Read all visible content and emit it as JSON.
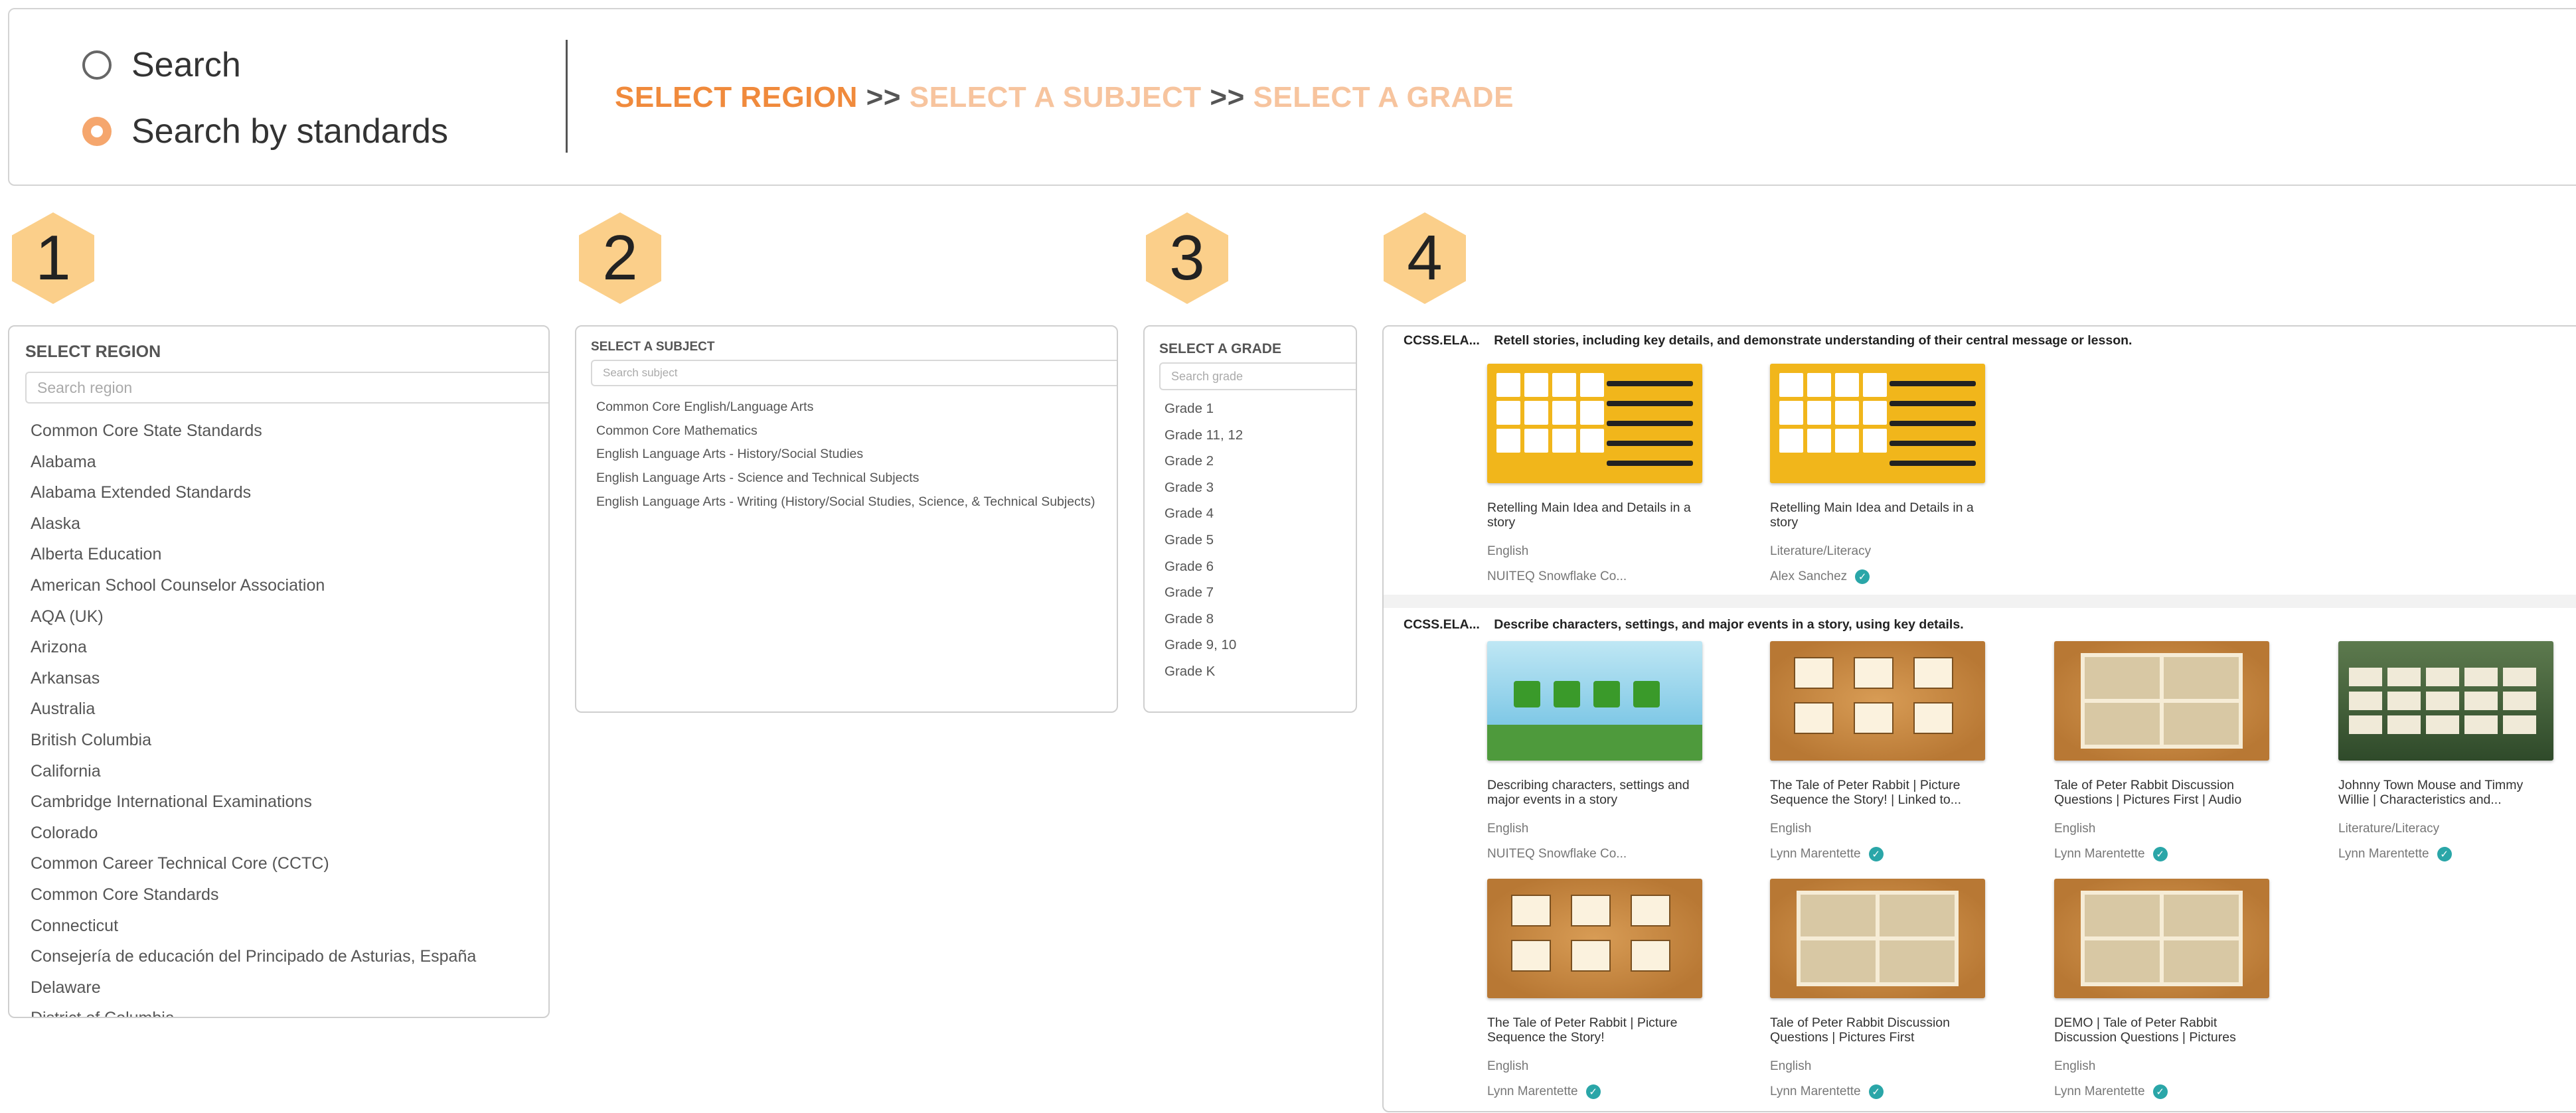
{
  "search_mode": {
    "options": [
      {
        "label": "Search",
        "selected": false
      },
      {
        "label": "Search by standards",
        "selected": true
      }
    ]
  },
  "breadcrumb": {
    "step1": "SELECT REGION",
    "sep": ">>",
    "step2": "SELECT A SUBJECT",
    "step3": "SELECT A GRADE"
  },
  "steps": [
    "1",
    "2",
    "3",
    "4"
  ],
  "region_panel": {
    "title": "SELECT REGION",
    "search_placeholder": "Search region",
    "items": [
      "Common Core State Standards",
      "Alabama",
      "Alabama Extended Standards",
      "Alaska",
      "Alberta Education",
      "American School Counselor Association",
      "AQA (UK)",
      "Arizona",
      "Arkansas",
      "Australia",
      "British Columbia",
      "California",
      "Cambridge International Examinations",
      "Colorado",
      "Common Career Technical Core (CCTC)",
      "Common Core Standards",
      "Connecticut",
      "Consejería de educación del Principado de Asturias, España",
      "Delaware",
      "District of Columbia"
    ]
  },
  "subject_panel": {
    "title": "SELECT A SUBJECT",
    "search_placeholder": "Search subject",
    "items": [
      "Common Core English/Language Arts",
      "Common Core Mathematics",
      "English Language Arts - History/Social Studies",
      "English Language Arts - Science and Technical Subjects",
      "English Language Arts - Writing (History/Social Studies, Science, & Technical Subjects)"
    ]
  },
  "grade_panel": {
    "title": "SELECT A GRADE",
    "search_placeholder": "Search grade",
    "items": [
      "Grade 1",
      "Grade 11, 12",
      "Grade 2",
      "Grade 3",
      "Grade 4",
      "Grade 5",
      "Grade 6",
      "Grade 7",
      "Grade 8",
      "Grade 9, 10",
      "Grade K"
    ]
  },
  "results": {
    "standards": [
      {
        "code": "CCSS.ELA...",
        "description": "Retell stories, including key details, and demonstrate understanding of their central message or lesson.",
        "cards": [
          {
            "title": "Retelling Main Idea and Details in a story",
            "subject": "English",
            "author": "NUITEQ Snowflake Co...",
            "verified": false,
            "thumb": "yellow"
          },
          {
            "title": "Retelling Main Idea and Details in a story",
            "subject": "Literature/Literacy",
            "author": "Alex Sanchez",
            "verified": true,
            "thumb": "yellow"
          }
        ]
      },
      {
        "code": "CCSS.ELA...",
        "description": "Describe characters, settings, and major events in a story, using key details.",
        "cards": [
          {
            "title": "Describing characters, settings and major events in a story",
            "subject": "English",
            "author": "NUITEQ Snowflake Co...",
            "verified": false,
            "thumb": "sky"
          },
          {
            "title": "The Tale of Peter Rabbit | Picture Sequence the Story! | Linked to...",
            "subject": "English",
            "author": "Lynn Marentette",
            "verified": true,
            "thumb": "brown-frames"
          },
          {
            "title": "Tale of Peter Rabbit Discussion Questions | Pictures First | Audio",
            "subject": "English",
            "author": "Lynn Marentette",
            "verified": true,
            "thumb": "brown-book"
          },
          {
            "title": "Johnny Town Mouse and Timmy Willie | Characteristics and...",
            "subject": "Literature/Literacy",
            "author": "Lynn Marentette",
            "verified": true,
            "thumb": "town"
          },
          {
            "title": "The Tale of Peter Rabbit | Picture Sequence the Story!",
            "subject": "English",
            "author": "Lynn Marentette",
            "verified": true,
            "thumb": "brown-frames"
          },
          {
            "title": "Tale of Peter Rabbit Discussion Questions | Pictures First",
            "subject": "English",
            "author": "Lynn Marentette",
            "verified": true,
            "thumb": "brown-book"
          },
          {
            "title": "DEMO | Tale of Peter Rabbit Discussion Questions | Pictures",
            "subject": "English",
            "author": "Lynn Marentette",
            "verified": true,
            "thumb": "brown-book"
          }
        ]
      }
    ]
  }
}
